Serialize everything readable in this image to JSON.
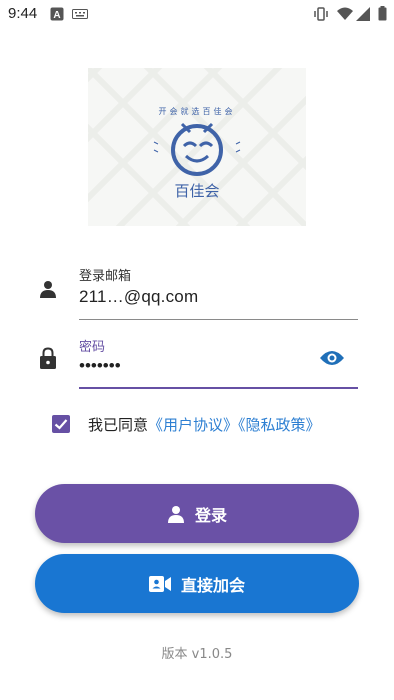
{
  "status_bar": {
    "time": "9:44"
  },
  "logo": {
    "ring_text": "开会就选百佳会",
    "name": "百佳会"
  },
  "email_field": {
    "label": "登录邮箱",
    "value": "211…@qq.com"
  },
  "password_field": {
    "label": "密码",
    "value": "•••••••"
  },
  "agreement": {
    "checked": true,
    "prefix": "我已同意",
    "user_agreement": "《用户协议》",
    "privacy_policy": "《隐私政策》"
  },
  "buttons": {
    "login": "登录",
    "direct_join": "直接加会"
  },
  "version": "版本 v1.0.5",
  "colors": {
    "primary": "#6a51a6",
    "accent": "#1976d2",
    "link": "#2d7fd2",
    "logo_blue": "#3f63a8"
  },
  "icons": [
    "person-icon",
    "lock-icon",
    "eye-icon",
    "checkbox-check-icon",
    "video-camera-icon"
  ]
}
